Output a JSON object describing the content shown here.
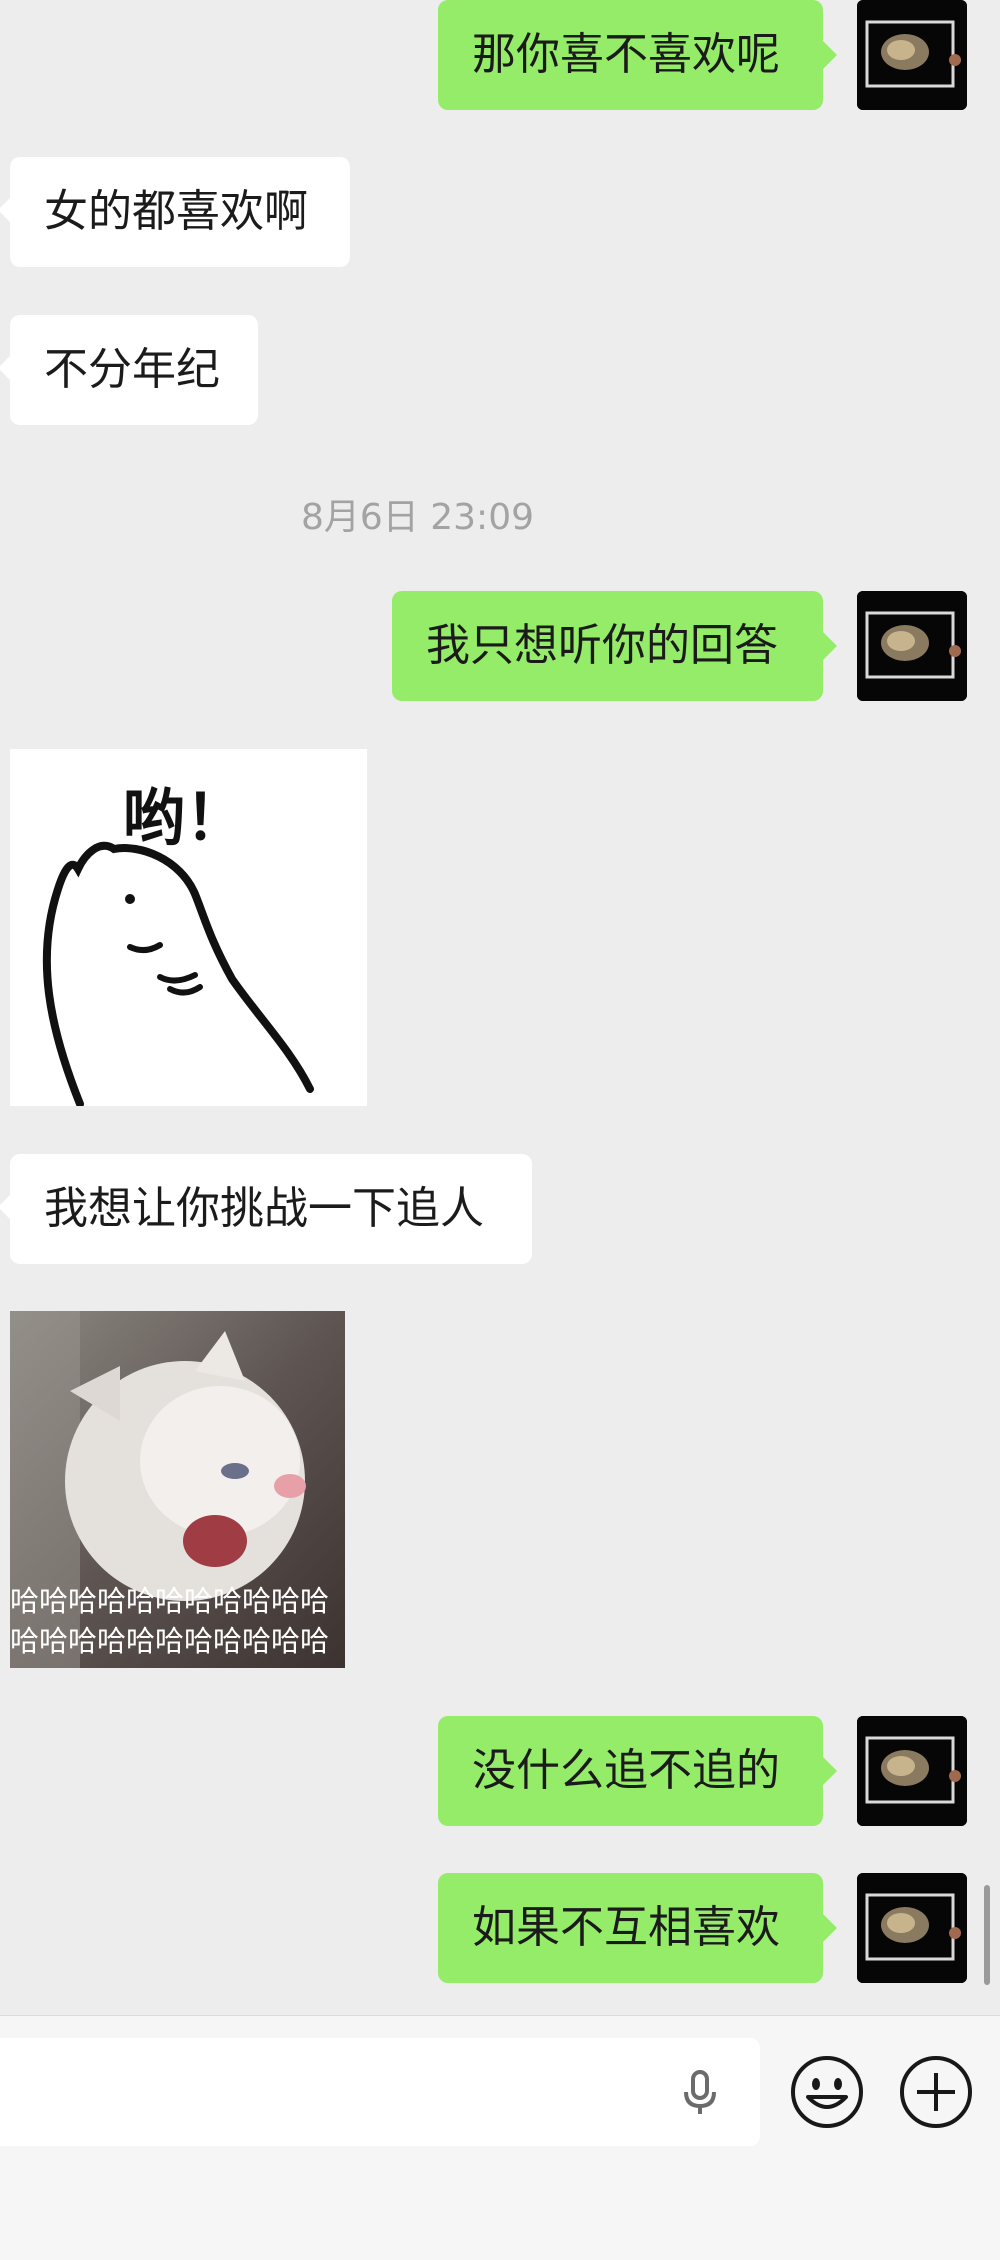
{
  "messages": {
    "m1": {
      "text": "那你喜不喜欢呢",
      "side": "out"
    },
    "m2": {
      "text": "女的都喜欢啊",
      "side": "in"
    },
    "m3": {
      "text": "不分年纪",
      "side": "in"
    },
    "timestamp": "8月6日 23:09",
    "m4": {
      "text": "我只想听你的回答",
      "side": "out"
    },
    "sticker1": {
      "caption": "哟！"
    },
    "m5": {
      "text": "我想让你挑战一下追人",
      "side": "in"
    },
    "sticker2": {
      "line1": "哈哈哈哈哈哈哈哈哈哈哈",
      "line2": "哈哈哈哈哈哈哈哈哈哈哈"
    },
    "m6": {
      "text": "没什么追不追的",
      "side": "out"
    },
    "m7": {
      "text": "如果不互相喜欢",
      "side": "out"
    }
  },
  "input": {
    "value": "",
    "icons": [
      "microphone-icon",
      "emoji-icon",
      "plus-icon"
    ]
  },
  "colors": {
    "background": "#ededed",
    "outgoing_bubble": "#95ec69",
    "incoming_bubble": "#ffffff",
    "timestamp_text": "#a3a3a3"
  }
}
